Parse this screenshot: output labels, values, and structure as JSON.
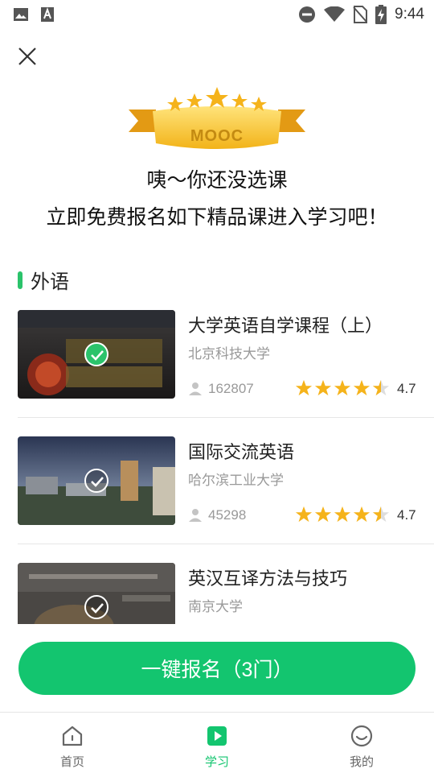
{
  "status_bar": {
    "time": "9:44"
  },
  "banner": {
    "badge_text": "MOOC"
  },
  "headline": {
    "line1": "咦～你还没选课",
    "line2": "立即免费报名如下精品课进入学习吧！"
  },
  "section": {
    "title": "外语"
  },
  "courses": [
    {
      "title": "大学英语自学课程（上）",
      "school": "北京科技大学",
      "learners": "162807",
      "rating": "4.7",
      "rating_value": 4.7,
      "selected": true
    },
    {
      "title": "国际交流英语",
      "school": "哈尔滨工业大学",
      "learners": "45298",
      "rating": "4.7",
      "rating_value": 4.7,
      "selected": true
    },
    {
      "title": "英汉互译方法与技巧",
      "school": "南京大学",
      "selected": true
    }
  ],
  "cta": {
    "label": "一键报名（3门）"
  },
  "bottom_nav": {
    "items": [
      {
        "label": "首页",
        "icon": "home-icon",
        "active": false
      },
      {
        "label": "学习",
        "icon": "play-icon",
        "active": true
      },
      {
        "label": "我的",
        "icon": "smile-icon",
        "active": false
      }
    ]
  },
  "colors": {
    "accent": "#13c56f",
    "star": "#f5b31b",
    "text_secondary": "#999999"
  }
}
